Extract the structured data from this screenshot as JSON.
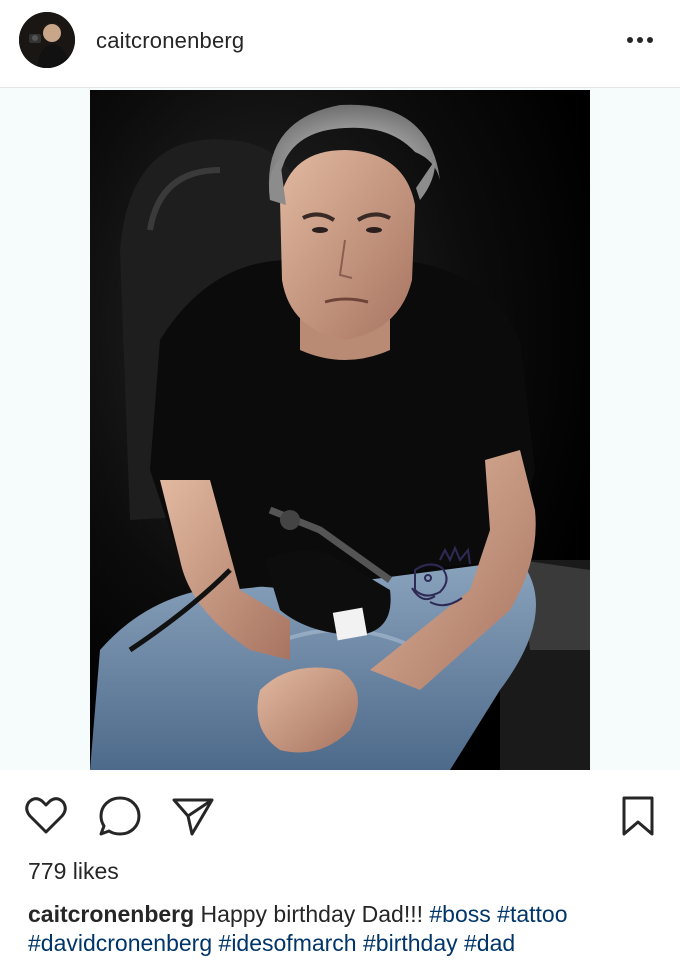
{
  "header": {
    "username": "caitcronenberg",
    "avatar_icon": "profile-avatar",
    "more_icon": "more-horizontal-icon"
  },
  "media": {
    "alt_icon": "photo"
  },
  "actions": {
    "like_icon": "heart-icon",
    "comment_icon": "comment-icon",
    "share_icon": "send-icon",
    "save_icon": "bookmark-icon"
  },
  "likes": {
    "text": "779 likes"
  },
  "caption": {
    "username": "caitcronenberg",
    "text": "Happy birthday Dad!!!",
    "hashtags": [
      "#boss",
      "#tattoo",
      "#davidcronenberg",
      "#idesofmarch",
      "#birthday",
      "#dad"
    ]
  },
  "colors": {
    "text": "#262626",
    "hashtag": "#003569",
    "divider": "#e6e6e6",
    "media_bg": "#f6fcfc"
  }
}
